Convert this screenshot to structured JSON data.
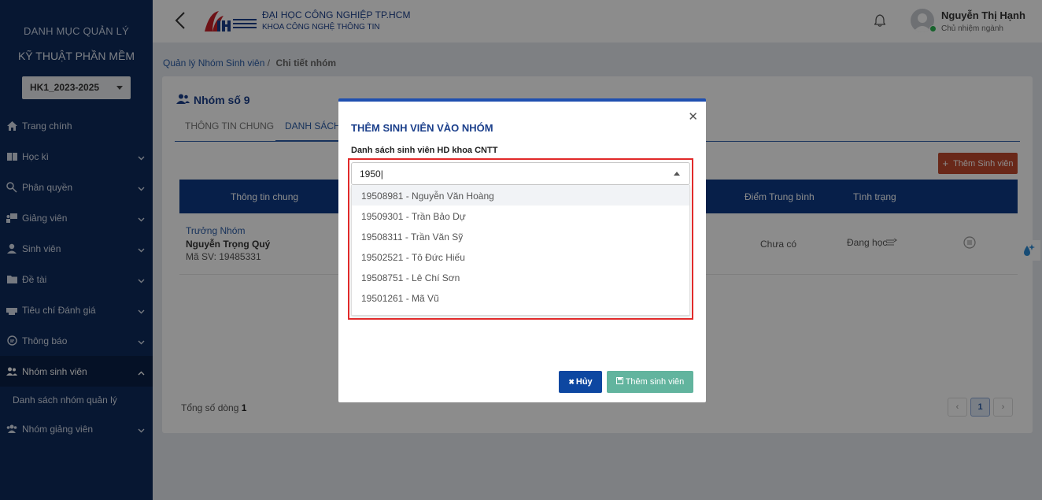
{
  "sidebar": {
    "title1": "DANH MỤC QUẢN LÝ",
    "title2": "KỸ THUẬT PHẦN MỀM",
    "semester": "HK1_2023-2025",
    "items": [
      {
        "label": "Trang chính",
        "icon": "home-icon"
      },
      {
        "label": "Học kì",
        "icon": "book-icon"
      },
      {
        "label": "Phân quyền",
        "icon": "key-icon"
      },
      {
        "label": "Giảng viên",
        "icon": "teacher-icon"
      },
      {
        "label": "Sinh viên",
        "icon": "student-icon"
      },
      {
        "label": "Đề tài",
        "icon": "folder-icon"
      },
      {
        "label": "Tiêu chí Đánh giá",
        "icon": "printer-icon"
      },
      {
        "label": "Thông báo",
        "icon": "message-icon"
      },
      {
        "label": "Nhóm sinh viên",
        "icon": "group-icon"
      },
      {
        "label": "Nhóm giảng viên",
        "icon": "group-icon"
      }
    ],
    "sub_item": "Danh sách nhóm quản lý"
  },
  "header": {
    "university": "ĐẠI HỌC CÔNG NGHIỆP TP.HCM",
    "faculty": "KHOA CÔNG NGHỆ THÔNG TIN",
    "user_name": "Nguyễn Thị Hạnh",
    "user_role": "Chủ nhiệm ngành"
  },
  "breadcrumb": {
    "parent": "Quản lý Nhóm Sinh viên",
    "separator": "/",
    "current": "Chi tiết nhóm"
  },
  "group": {
    "title": "Nhóm số 9",
    "tabs": [
      "THÔNG TIN CHUNG",
      "DANH SÁCH"
    ],
    "add_button": "Thêm Sinh viên",
    "columns": [
      "Thông tin chung",
      "Điểm Trung bình",
      "Tình trạng"
    ],
    "row": {
      "role": "Trưởng Nhóm",
      "name": "Nguyễn Trọng Quý",
      "student_id": "Mã SV: 19485331",
      "score": "Chưa có",
      "status": "Đang học"
    },
    "total_label": "Tổng số dòng",
    "total_value": "1",
    "page": "1"
  },
  "modal": {
    "title": "THÊM SINH VIÊN VÀO NHÓM",
    "label": "Danh sách sinh viên HD khoa CNTT",
    "input_value": "1950",
    "options": [
      "19508981 - Nguyễn Văn Hoàng",
      "19509301 - Trần Bảo Dự",
      "19508311 - Trần Văn Sỹ",
      "19502521 - Tô Đức Hiếu",
      "19508751 - Lê Chí Sơn",
      "19501261 - Mã Vũ"
    ],
    "cancel_label": "Hủy",
    "submit_label": "Thêm sinh viên"
  },
  "colors": {
    "sidebar_bg": "#0d2a5c",
    "primary": "#1b3f8b",
    "danger": "#c0492f",
    "highlight": "#e12a2a"
  }
}
